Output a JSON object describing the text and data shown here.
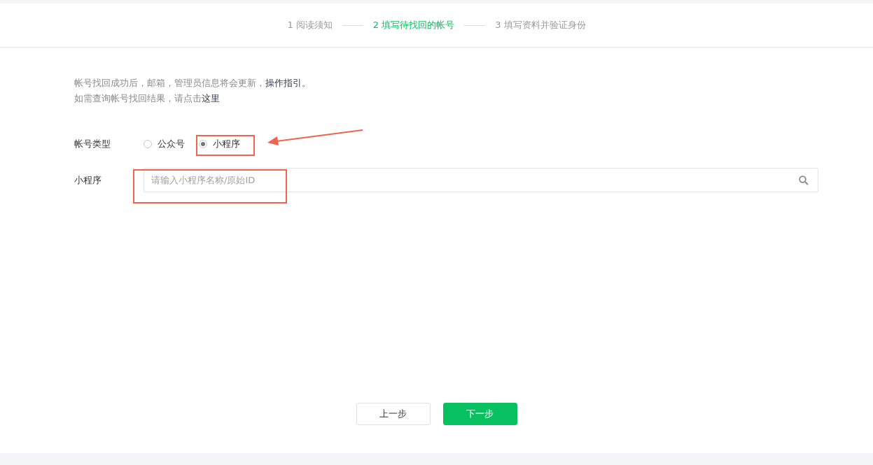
{
  "steps": [
    {
      "label": "1 阅读须知",
      "current": false
    },
    {
      "label": "2 填写待找回的帐号",
      "current": true
    },
    {
      "label": "3 填写资料并验证身份",
      "current": false
    }
  ],
  "notice": [
    {
      "text": "帐号找回成功后，邮箱，管理员信息将会更新，",
      "link": "操作指引。"
    },
    {
      "text": "如需查询帐号找回结果，请点击",
      "link": "这里"
    }
  ],
  "account_type": {
    "label": "帐号类型",
    "options": [
      {
        "label": "公众号",
        "selected": false
      },
      {
        "label": "小程序",
        "selected": true
      }
    ]
  },
  "mini_program": {
    "label": "小程序",
    "placeholder": "请输入小程序名称/原始ID"
  },
  "buttons": [
    {
      "label": "上一步",
      "kind": "secondary"
    },
    {
      "label": "下一步",
      "kind": "primary"
    }
  ]
}
